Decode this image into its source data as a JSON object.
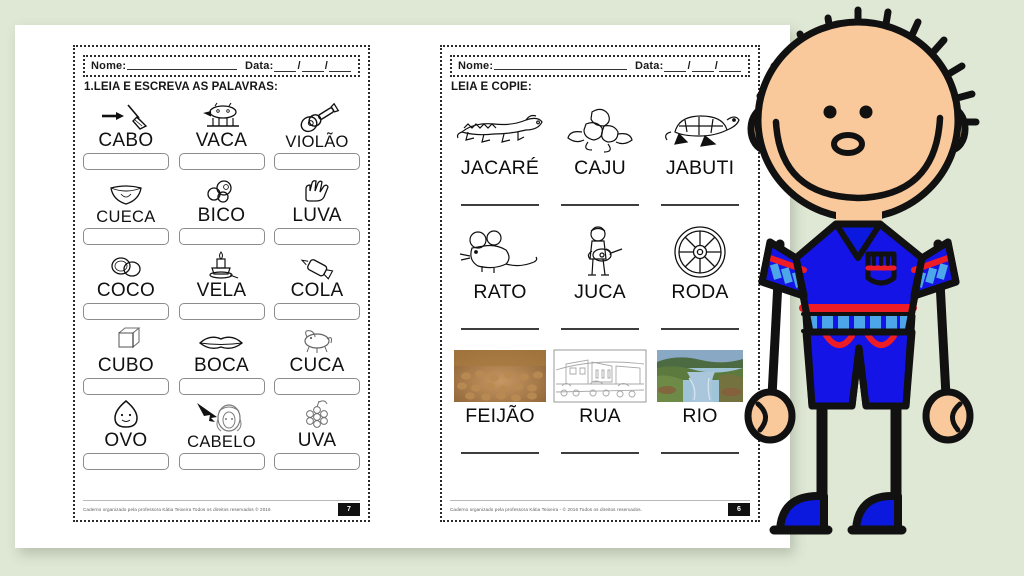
{
  "background_color": "#dfe8d5",
  "left_page": {
    "name_label": "Nome:",
    "date_label": "Data:",
    "instruction": "1.LEIA E ESCREVA AS PALAVRAS:",
    "rows": [
      [
        {
          "word": "CABO",
          "icon": "broom-icon"
        },
        {
          "word": "VACA",
          "icon": "cow-icon"
        },
        {
          "word": "VIOLÃO",
          "icon": "guitar-icon"
        }
      ],
      [
        {
          "word": "CUECA",
          "icon": "underwear-icon"
        },
        {
          "word": "BICO",
          "icon": "pacifier-icon"
        },
        {
          "word": "LUVA",
          "icon": "glove-icon"
        }
      ],
      [
        {
          "word": "COCO",
          "icon": "coconut-icon"
        },
        {
          "word": "VELA",
          "icon": "candle-icon"
        },
        {
          "word": "COLA",
          "icon": "glue-icon"
        }
      ],
      [
        {
          "word": "CUBO",
          "icon": "cube-icon"
        },
        {
          "word": "BOCA",
          "icon": "mouth-icon"
        },
        {
          "word": "CUCA",
          "icon": "cuca-icon"
        }
      ],
      [
        {
          "word": "OVO",
          "icon": "egg-icon"
        },
        {
          "word": "CABELO",
          "icon": "hair-icon"
        },
        {
          "word": "UVA",
          "icon": "grapes-icon"
        }
      ]
    ],
    "footer_text": "Caderno organizado pela professora Kátia Teixeira    Todos os direitos reservados © 2016",
    "page_number": "7"
  },
  "right_page": {
    "name_label": "Nome:",
    "date_label": "Data:",
    "instruction": "LEIA E COPIE:",
    "rows": [
      [
        {
          "word": "JACARÉ",
          "icon": "alligator-icon"
        },
        {
          "word": "CAJU",
          "icon": "cashew-icon"
        },
        {
          "word": "JABUTI",
          "icon": "tortoise-icon"
        }
      ],
      [
        {
          "word": "RATO",
          "icon": "mouse-icon"
        },
        {
          "word": "JUCA",
          "icon": "boy-guitar-icon"
        },
        {
          "word": "RODA",
          "icon": "wheel-icon"
        }
      ],
      [
        {
          "word": "FEIJÃO",
          "icon": "beans-photo"
        },
        {
          "word": "RUA",
          "icon": "street-photo"
        },
        {
          "word": "RIO",
          "icon": "river-photo"
        }
      ]
    ],
    "footer_text": "Caderno organizado pela professora Kátia Teixeira - © 2016 Todos os direitos reservados.",
    "page_number": "6"
  },
  "character": {
    "name": "cartoon-boy",
    "skin_color": "#f9c89b",
    "shirt_color": "#1414e6",
    "accent_red": "#ee1c25",
    "accent_light_blue": "#4da6e8",
    "outline_color": "#111111"
  }
}
